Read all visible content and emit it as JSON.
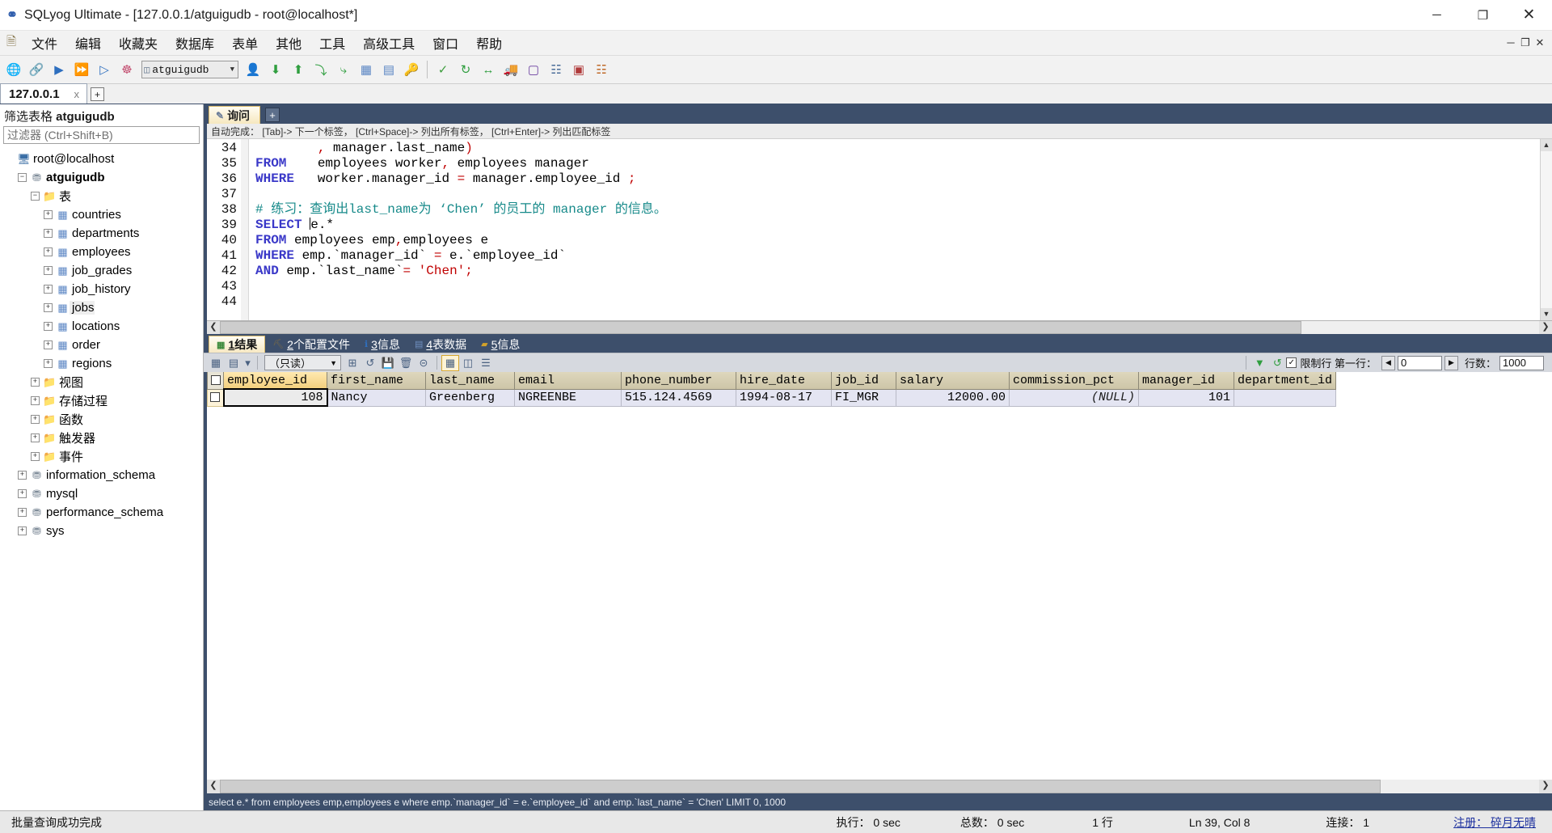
{
  "window": {
    "title": "SQLyog Ultimate - [127.0.0.1/atguigudb - root@localhost*]",
    "app_icon": "sqlyog-icon",
    "minimize": "─",
    "maximize": "❐",
    "close": "✕"
  },
  "menu": {
    "items": [
      "文件",
      "编辑",
      "收藏夹",
      "数据库",
      "表单",
      "其他",
      "工具",
      "高级工具",
      "窗口",
      "帮助"
    ],
    "mdi_minimize": "─",
    "mdi_restore": "❐",
    "mdi_close": "✕"
  },
  "toolbar": {
    "database_value": "atguigudb",
    "icons": [
      "connection-manager-icon",
      "new-connection-icon",
      "execute-query-icon",
      "execute-all-queries-icon",
      "execute-current-icon",
      "refresh-objects-icon"
    ],
    "icons2": [
      "user-manager-icon",
      "backup-database-icon",
      "restore-database-icon",
      "import-data-icon",
      "export-data-icon",
      "table-data-icon",
      "table-structure-icon",
      "key-icon"
    ],
    "icons3": [
      "validate-icon",
      "sync-icon",
      "schema-compare-icon",
      "migration-icon",
      "data-sync-icon",
      "query-builder-icon",
      "html-report-icon",
      "scheduler-icon"
    ]
  },
  "connection_tabs": {
    "tabs": [
      {
        "label": "127.0.0.1",
        "close": "x"
      }
    ],
    "add": "+"
  },
  "sidebar": {
    "filter_label_prefix": "筛选表格 ",
    "filter_label_db": "atguigudb",
    "filter_placeholder": "过滤器 (Ctrl+Shift+B)",
    "tree": [
      {
        "label": "root@localhost",
        "indent": 0,
        "expander": "",
        "icon": "server-icon",
        "bold": false
      },
      {
        "label": "atguigudb",
        "indent": 1,
        "expander": "−",
        "icon": "database-icon",
        "bold": true
      },
      {
        "label": "表",
        "indent": 2,
        "expander": "−",
        "icon": "folder-icon",
        "bold": false
      },
      {
        "label": "countries",
        "indent": 3,
        "expander": "+",
        "icon": "table-icon",
        "bold": false
      },
      {
        "label": "departments",
        "indent": 3,
        "expander": "+",
        "icon": "table-icon",
        "bold": false
      },
      {
        "label": "employees",
        "indent": 3,
        "expander": "+",
        "icon": "table-icon",
        "bold": false
      },
      {
        "label": "job_grades",
        "indent": 3,
        "expander": "+",
        "icon": "table-icon",
        "bold": false
      },
      {
        "label": "job_history",
        "indent": 3,
        "expander": "+",
        "icon": "table-icon",
        "bold": false
      },
      {
        "label": "jobs",
        "indent": 3,
        "expander": "+",
        "icon": "table-icon",
        "bold": false,
        "selected": true
      },
      {
        "label": "locations",
        "indent": 3,
        "expander": "+",
        "icon": "table-icon",
        "bold": false
      },
      {
        "label": "order",
        "indent": 3,
        "expander": "+",
        "icon": "table-icon",
        "bold": false
      },
      {
        "label": "regions",
        "indent": 3,
        "expander": "+",
        "icon": "table-icon",
        "bold": false
      },
      {
        "label": "视图",
        "indent": 2,
        "expander": "+",
        "icon": "folder-icon",
        "bold": false
      },
      {
        "label": "存储过程",
        "indent": 2,
        "expander": "+",
        "icon": "folder-icon",
        "bold": false
      },
      {
        "label": "函数",
        "indent": 2,
        "expander": "+",
        "icon": "folder-icon",
        "bold": false
      },
      {
        "label": "触发器",
        "indent": 2,
        "expander": "+",
        "icon": "folder-icon",
        "bold": false
      },
      {
        "label": "事件",
        "indent": 2,
        "expander": "+",
        "icon": "folder-icon",
        "bold": false
      },
      {
        "label": "information_schema",
        "indent": 1,
        "expander": "+",
        "icon": "database-icon",
        "bold": false
      },
      {
        "label": "mysql",
        "indent": 1,
        "expander": "+",
        "icon": "database-icon",
        "bold": false
      },
      {
        "label": "performance_schema",
        "indent": 1,
        "expander": "+",
        "icon": "database-icon",
        "bold": false
      },
      {
        "label": "sys",
        "indent": 1,
        "expander": "+",
        "icon": "database-icon",
        "bold": false
      }
    ]
  },
  "query_tabs": {
    "tabs": [
      {
        "label": "询问",
        "icon": "query-tab-icon"
      }
    ],
    "add": "+"
  },
  "editor": {
    "autocomplete_hint": "自动完成： [Tab]-> 下一个标签， [Ctrl+Space]-> 列出所有标签， [Ctrl+Enter]-> 列出匹配标签",
    "first_line_number": 34,
    "lines": [
      {
        "n": 34,
        "tokens": [
          {
            "t": "        , ",
            "c": "punc"
          },
          {
            "t": "manager.last_name",
            "c": ""
          },
          {
            "t": ")",
            "c": "punc"
          }
        ]
      },
      {
        "n": 35,
        "tokens": [
          {
            "t": "FROM",
            "c": "kw"
          },
          {
            "t": "    employees worker",
            "c": ""
          },
          {
            "t": ",",
            "c": "punc"
          },
          {
            "t": " employees manager",
            "c": ""
          }
        ]
      },
      {
        "n": 36,
        "tokens": [
          {
            "t": "WHERE",
            "c": "kw"
          },
          {
            "t": "   worker.manager_id ",
            "c": ""
          },
          {
            "t": "=",
            "c": "punc"
          },
          {
            "t": " manager.employee_id ",
            "c": ""
          },
          {
            "t": ";",
            "c": "punc"
          }
        ]
      },
      {
        "n": 37,
        "tokens": []
      },
      {
        "n": 38,
        "tokens": [
          {
            "t": "# 练习：查询出last_name为 ‘Chen’ 的员工的 manager 的信息。",
            "c": "cmt"
          }
        ]
      },
      {
        "n": 39,
        "tokens": [
          {
            "t": "SELECT",
            "c": "kw"
          },
          {
            "t": " ",
            "c": ""
          },
          {
            "t": "CARET",
            "c": "caret"
          },
          {
            "t": "e.*",
            "c": ""
          }
        ]
      },
      {
        "n": 40,
        "tokens": [
          {
            "t": "FROM",
            "c": "kw"
          },
          {
            "t": " employees emp",
            "c": ""
          },
          {
            "t": ",",
            "c": "punc"
          },
          {
            "t": "employees e",
            "c": ""
          }
        ]
      },
      {
        "n": 41,
        "tokens": [
          {
            "t": "WHERE",
            "c": "kw"
          },
          {
            "t": " emp.`manager_id` ",
            "c": ""
          },
          {
            "t": "=",
            "c": "punc"
          },
          {
            "t": " e.`employee_id`",
            "c": ""
          }
        ]
      },
      {
        "n": 42,
        "tokens": [
          {
            "t": "AND",
            "c": "kw"
          },
          {
            "t": " emp.`last_name`",
            "c": ""
          },
          {
            "t": "=",
            "c": "punc"
          },
          {
            "t": " ",
            "c": ""
          },
          {
            "t": "'Chen'",
            "c": "str"
          },
          {
            "t": ";",
            "c": "punc"
          }
        ]
      },
      {
        "n": 43,
        "tokens": []
      },
      {
        "n": 44,
        "tokens": []
      }
    ]
  },
  "result_tabs": [
    {
      "num": "1",
      "label": "结果",
      "icon": "result-grid-icon",
      "active": true
    },
    {
      "num": "2",
      "label": "个配置文件",
      "icon": "profile-icon",
      "active": false
    },
    {
      "num": "3",
      "label": "信息",
      "icon": "info-icon",
      "active": false
    },
    {
      "num": "4",
      "label": "表数据",
      "icon": "table-data-icon",
      "active": false
    },
    {
      "num": "5",
      "label": "信息",
      "icon": "messages-icon",
      "active": false
    }
  ],
  "grid_toolbar": {
    "mode_value": "（只读）",
    "left_icons": [
      "grid-view-icon",
      "grid-options-icon"
    ],
    "dropdown_arrow": "▾",
    "action_icons": [
      "insert-row-icon",
      "refresh-row-icon",
      "save-changes-icon",
      "delete-row-icon",
      "discard-changes-icon"
    ],
    "view_icons": [
      "grid-mode-icon",
      "form-mode-icon",
      "text-mode-icon"
    ],
    "filter_icon": "filter-icon",
    "refresh_icon": "refresh-icon",
    "limit_checked": "✓",
    "limit_label": "限制行 第一行：",
    "offset_value": "0",
    "prev_arrow": "◀",
    "next_arrow": "▶",
    "rows_label": "行数：",
    "rows_value": "1000"
  },
  "result_grid": {
    "columns": [
      "employee_id",
      "first_name",
      "last_name",
      "email",
      "phone_number",
      "hire_date",
      "job_id",
      "salary",
      "commission_pct",
      "manager_id",
      "department_id"
    ],
    "rows": [
      {
        "employee_id": "108",
        "first_name": "Nancy",
        "last_name": "Greenberg",
        "email": "NGREENBE",
        "phone_number": "515.124.4569",
        "hire_date": "1994-08-17",
        "job_id": "FI_MGR",
        "salary": "12000.00",
        "commission_pct": "(NULL)",
        "manager_id": "101",
        "department_id": ""
      }
    ]
  },
  "sql_status_line": "select e.* from employees emp,employees e where emp.`manager_id` = e.`employee_id` and emp.`last_name` = 'Chen' LIMIT 0, 1000",
  "statusbar": {
    "message": "批量查询成功完成",
    "exec_time": "执行： 0 sec",
    "total_time": "总数： 0 sec",
    "row_count": "1 行",
    "cursor_pos": "Ln 39, Col 8",
    "connections": "连接： 1",
    "register": "注册： 碎月无晴"
  },
  "colors": {
    "accent_dark": "#3d4f6b",
    "tab_active": "#f7e9c3",
    "keyword": "#3a38c8",
    "comment": "#178a8a",
    "string": "#c00000",
    "grid_row": "#e4e5f2"
  }
}
